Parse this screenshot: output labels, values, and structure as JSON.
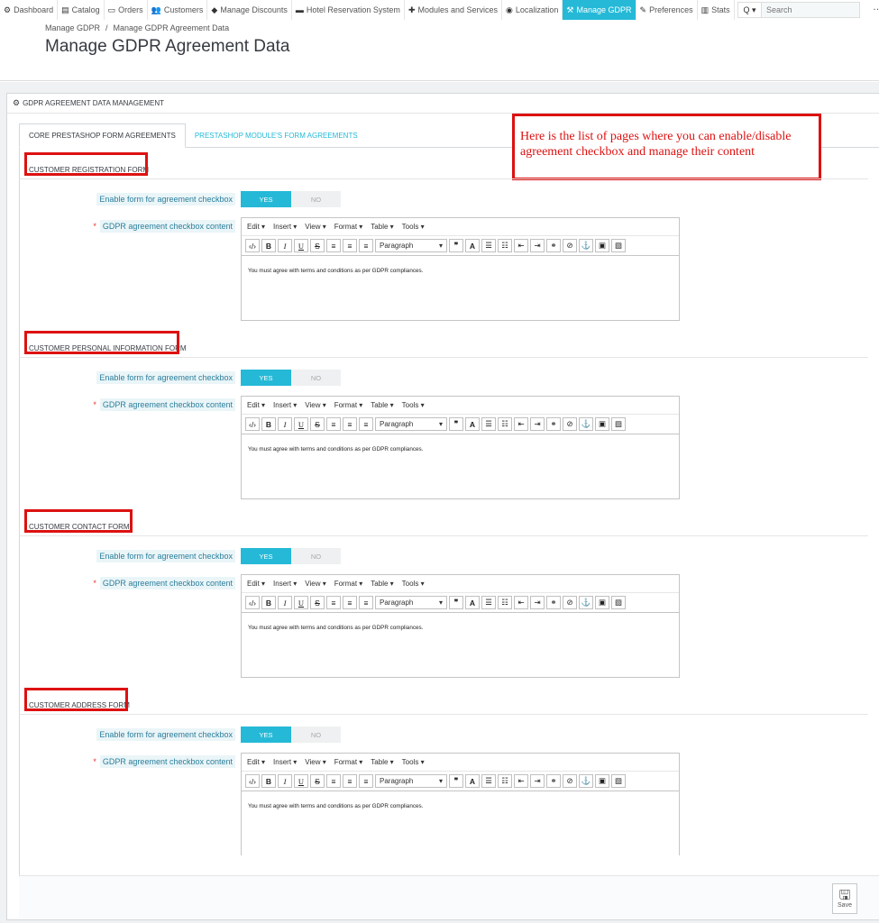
{
  "nav": {
    "items": [
      {
        "icon": "dashboard-icon",
        "glyph": "⚙",
        "label": "Dashboard"
      },
      {
        "icon": "catalog-icon",
        "glyph": "▤",
        "label": "Catalog"
      },
      {
        "icon": "orders-icon",
        "glyph": "▭",
        "label": "Orders"
      },
      {
        "icon": "customers-icon",
        "glyph": "👥",
        "label": "Customers"
      },
      {
        "icon": "tag-icon",
        "glyph": "◆",
        "label": "Manage Discounts"
      },
      {
        "icon": "bed-icon",
        "glyph": "▬",
        "label": "Hotel Reservation System"
      },
      {
        "icon": "puzzle-icon",
        "glyph": "✚",
        "label": "Modules and Services"
      },
      {
        "icon": "globe-icon",
        "glyph": "◉",
        "label": "Localization"
      },
      {
        "icon": "gavel-icon",
        "glyph": "⚒",
        "label": "Manage GDPR"
      },
      {
        "icon": "wrench-icon",
        "glyph": "✎",
        "label": "Preferences"
      },
      {
        "icon": "bar-chart-icon",
        "glyph": "▥",
        "label": "Stats"
      }
    ],
    "search_placeholder": "Search",
    "search_button": "Q ▾",
    "more": "…"
  },
  "breadcrumb": {
    "parent": "Manage GDPR",
    "separator": "/",
    "current": "Manage GDPR Agreement Data"
  },
  "page_title": "Manage GDPR Agreement Data",
  "panel": {
    "title": "GDPR AGREEMENT DATA MANAGEMENT",
    "tabs": [
      "CORE PRESTASHOP FORM AGREEMENTS",
      "PRESTASHOP MODULE'S FORM AGREEMENTS"
    ]
  },
  "annotation": "Here is the list of pages where you can enable/disable agreement checkbox and manage their content",
  "labels": {
    "enable": "Enable form for agreement checkbox",
    "content": "GDPR agreement checkbox content",
    "required": "*",
    "yes": "YES",
    "no": "NO"
  },
  "editor": {
    "menus": [
      "Edit ▾",
      "Insert ▾",
      "View ▾",
      "Format ▾",
      "Table ▾",
      "Tools ▾"
    ],
    "paragraph": "Paragraph",
    "default_text": "You must agree with terms and conditions as per GDPR compliances."
  },
  "sections": [
    {
      "title": "CUSTOMER REGISTRATION FORM",
      "content": "You must agree with terms and conditions as per GDPR compliances."
    },
    {
      "title": "CUSTOMER PERSONAL INFORMATION FORM",
      "content": "You must agree with terms and conditions as per GDPR compliances."
    },
    {
      "title": "CUSTOMER CONTACT FORM",
      "content": "You must agree with terms and conditions as per GDPR compliances."
    },
    {
      "title": "CUSTOMER ADDRESS FORM",
      "content": "You must agree with terms and conditions as per GDPR compliances."
    }
  ],
  "save_label": "Save"
}
